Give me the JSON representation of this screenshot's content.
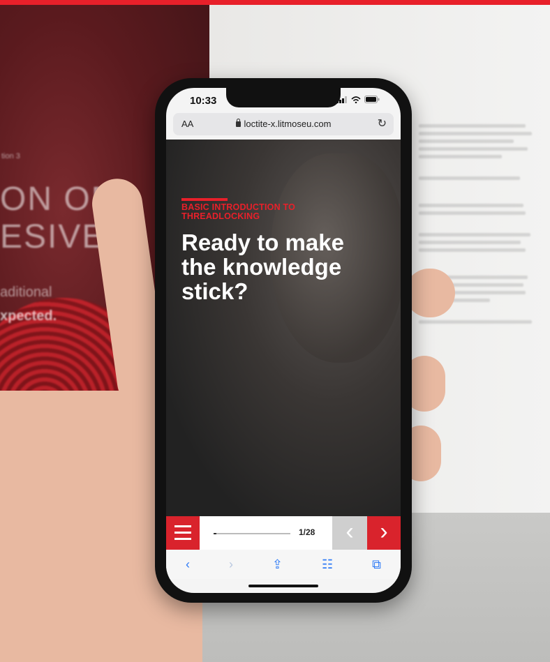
{
  "background": {
    "book_left_lines": [
      "tion 3",
      "ON OF",
      "ESIVE",
      "aditional",
      "xpected."
    ]
  },
  "status_bar": {
    "time": "10:33"
  },
  "browser": {
    "text_size_button": "AA",
    "url": "loctite-x.litmoseu.com"
  },
  "slide": {
    "kicker": "BASIC INTRODUCTION TO THREADLOCKING",
    "headline": "Ready to make the knowledge stick?"
  },
  "course_nav": {
    "page_indicator": "1/28",
    "progress_fraction": 0.036,
    "prev_icon": "chevron-left-icon",
    "next_icon": "chevron-right-icon"
  },
  "safari_toolbar": {
    "back_icon": "‹",
    "forward_icon": "›",
    "share_icon": "⇪",
    "bookmarks_icon": "☷",
    "tabs_icon": "⧉"
  },
  "colors": {
    "accent_red": "#e8202a",
    "safari_blue": "#2f7bf6"
  }
}
